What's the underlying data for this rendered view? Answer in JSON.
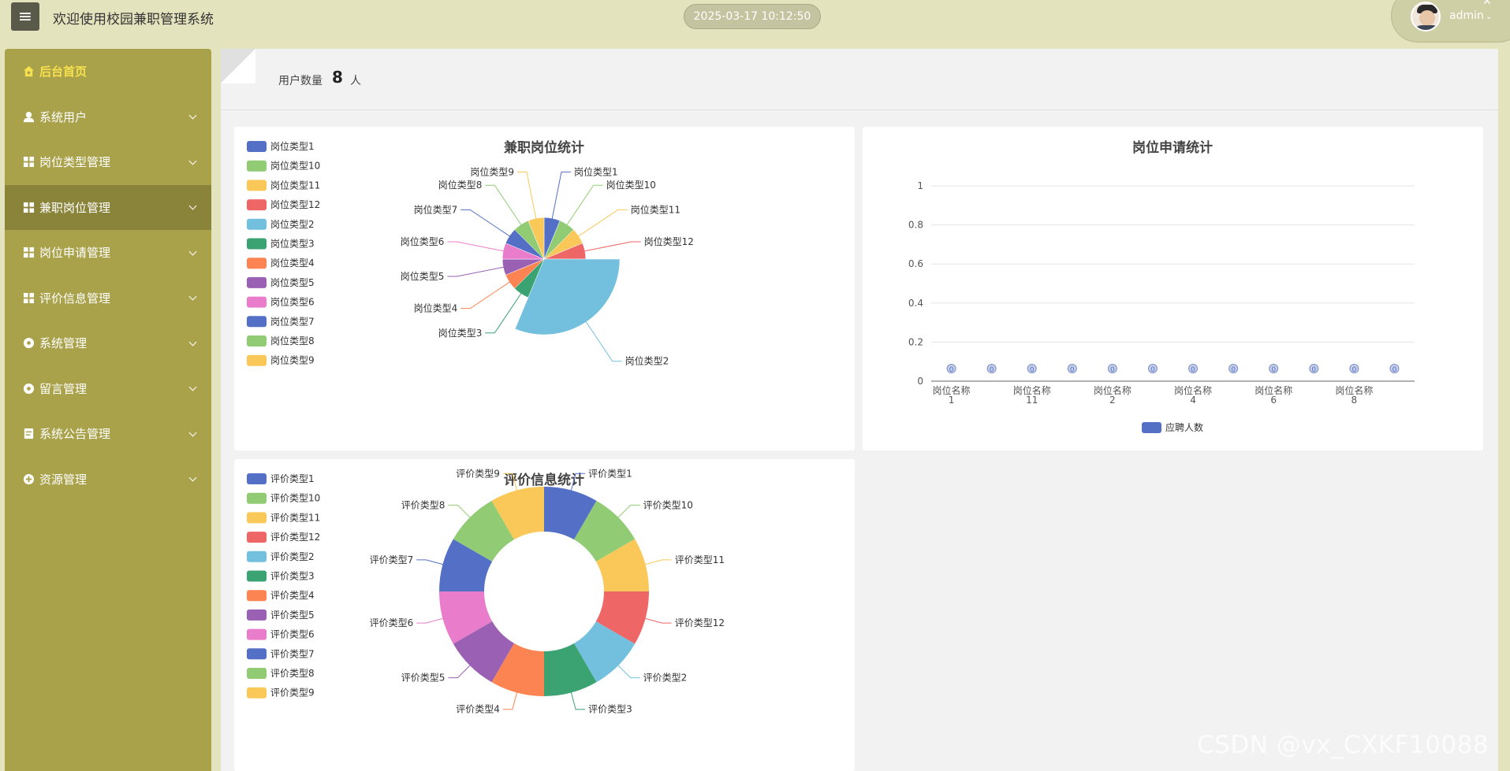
{
  "header": {
    "menu_icon": "hamburger-icon",
    "title": "欢迎使用校园兼职管理系统",
    "datetime": "2025-03-17 10:12:50",
    "user": "admin"
  },
  "sidebar": {
    "items": [
      {
        "label": "后台首页",
        "icon": "home-icon"
      },
      {
        "label": "系统用户",
        "icon": "user-icon"
      },
      {
        "label": "岗位类型管理",
        "icon": "grid-icon"
      },
      {
        "label": "兼职岗位管理",
        "icon": "grid-icon"
      },
      {
        "label": "岗位申请管理",
        "icon": "grid-icon"
      },
      {
        "label": "评价信息管理",
        "icon": "grid-icon"
      },
      {
        "label": "系统管理",
        "icon": "gear-icon"
      },
      {
        "label": "留言管理",
        "icon": "gear-icon"
      },
      {
        "label": "系统公告管理",
        "icon": "document-icon"
      },
      {
        "label": "资源管理",
        "icon": "plus-circle-icon"
      }
    ]
  },
  "stats": {
    "label": "用户数量",
    "value": "8",
    "unit": "人"
  },
  "colors": {
    "palette": [
      "#5470c6",
      "#91cc75",
      "#fac858",
      "#ee6666",
      "#73c0de",
      "#3ba272",
      "#fc8452",
      "#9a60b4",
      "#ea7ccc",
      "#5470c6",
      "#91cc75",
      "#fac858"
    ],
    "sidebar": "#a9a24b",
    "background": "#e3e3bd"
  },
  "chart_data": [
    {
      "type": "pie",
      "subtype": "rose",
      "title": "兼职岗位统计",
      "legend_position": "top-left",
      "categories": [
        "岗位类型1",
        "岗位类型10",
        "岗位类型11",
        "岗位类型12",
        "岗位类型2",
        "岗位类型3",
        "岗位类型4",
        "岗位类型5",
        "岗位类型6",
        "岗位类型7",
        "岗位类型8",
        "岗位类型9"
      ],
      "values": [
        1,
        1,
        1,
        1,
        5,
        1,
        1,
        1,
        1,
        1,
        1,
        1
      ]
    },
    {
      "type": "bar",
      "title": "岗位申请统计",
      "legend_position": "bottom",
      "series": [
        {
          "name": "应聘人数",
          "values": [
            0,
            0,
            0,
            0,
            0,
            0,
            0,
            0,
            0,
            0,
            0,
            0
          ]
        }
      ],
      "tick_labels": [
        "岗位名称\n1",
        "岗位名称\n11",
        "岗位名称\n2",
        "岗位名称\n4",
        "岗位名称\n6",
        "岗位名称\n8"
      ],
      "bar_count": 12,
      "ylim": [
        0,
        1
      ],
      "yticks": [
        "0",
        "0.2",
        "0.4",
        "0.6",
        "0.8",
        "1"
      ],
      "data_labels": [
        "0",
        "0",
        "0",
        "0",
        "0",
        "0",
        "0",
        "0",
        "0",
        "0",
        "0",
        "0"
      ],
      "grid": true
    },
    {
      "type": "pie",
      "subtype": "donut",
      "title": "评价信息统计",
      "legend_position": "top-left",
      "categories": [
        "评价类型1",
        "评价类型10",
        "评价类型11",
        "评价类型12",
        "评价类型2",
        "评价类型3",
        "评价类型4",
        "评价类型5",
        "评价类型6",
        "评价类型7",
        "评价类型8",
        "评价类型9"
      ],
      "values": [
        1,
        1,
        1,
        1,
        1,
        1,
        1,
        1,
        1,
        1,
        1,
        1
      ]
    }
  ],
  "watermark": "CSDN @vx_CXKF10088"
}
